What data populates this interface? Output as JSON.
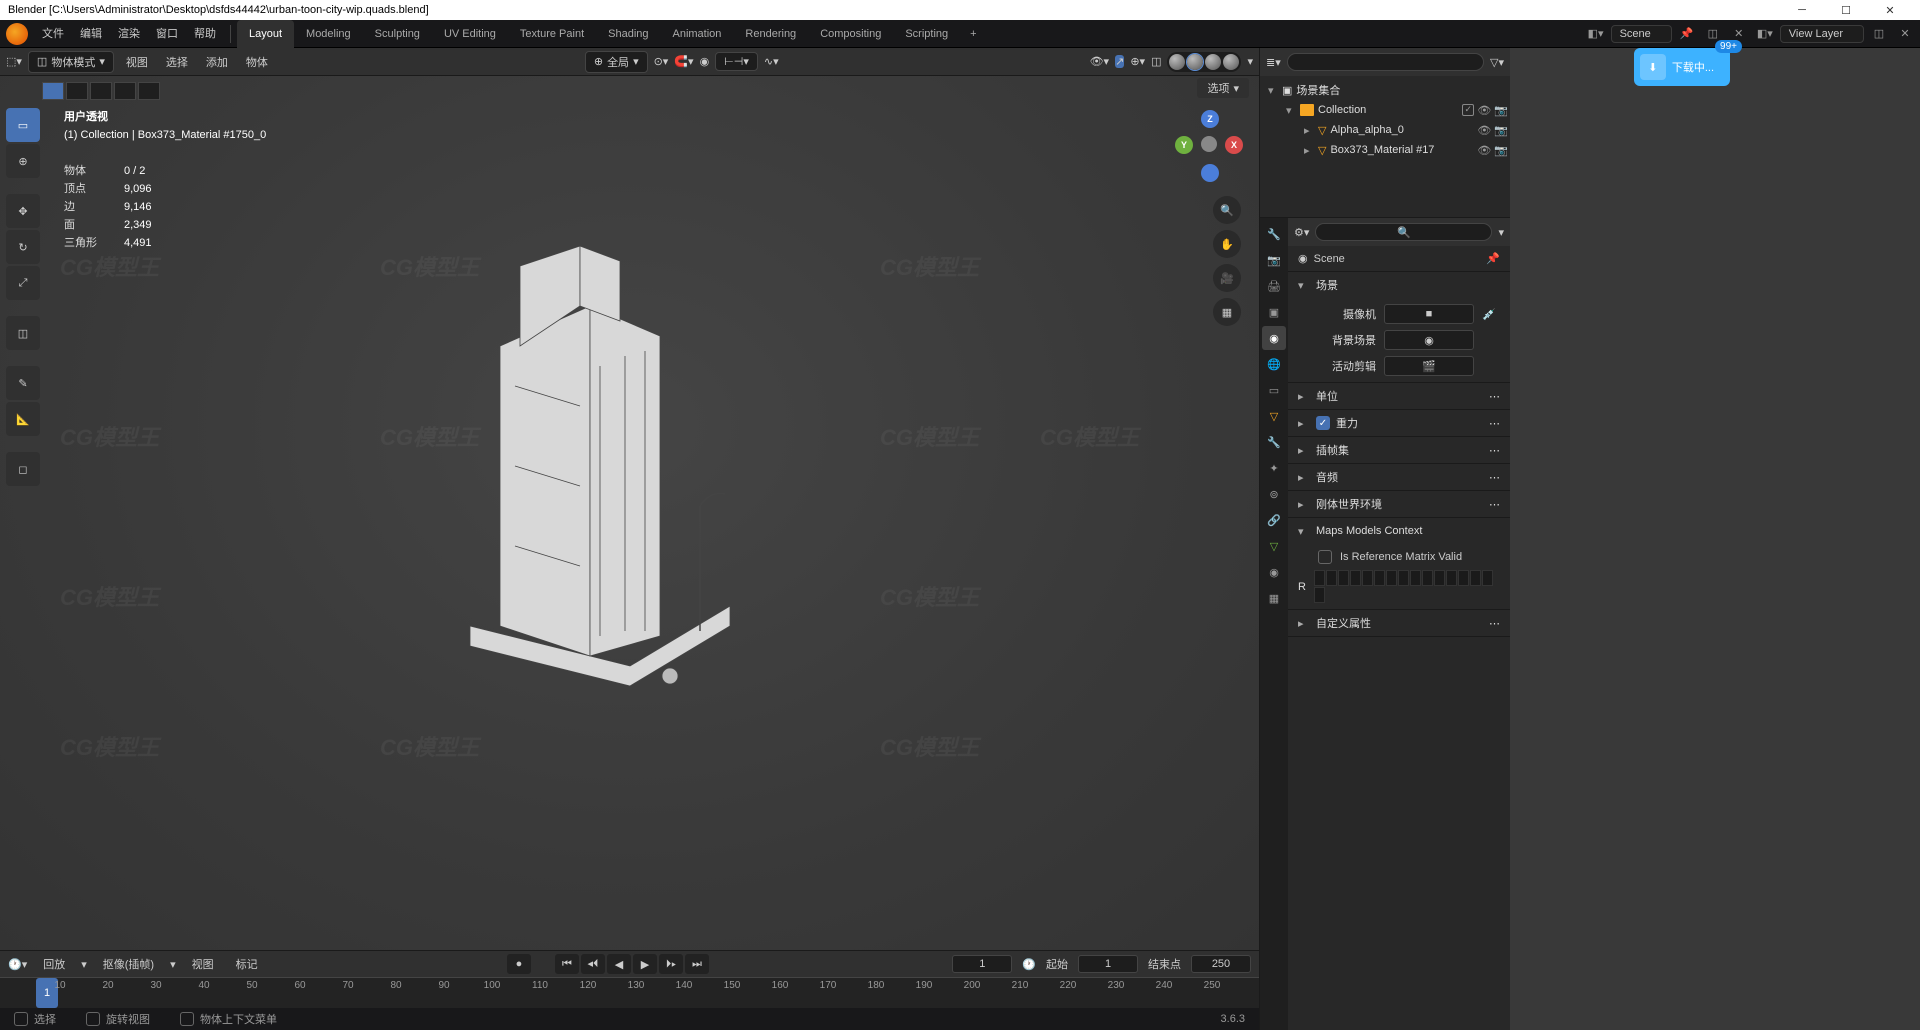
{
  "titlebar": {
    "title": "Blender [C:\\Users\\Administrator\\Desktop\\dsfds44442\\urban-toon-city-wip.quads.blend]"
  },
  "menu": {
    "items": [
      "文件",
      "编辑",
      "渲染",
      "窗口",
      "帮助"
    ]
  },
  "workspace_tabs": [
    "Layout",
    "Modeling",
    "Sculpting",
    "UV Editing",
    "Texture Paint",
    "Shading",
    "Animation",
    "Rendering",
    "Compositing",
    "Scripting"
  ],
  "scene_dropdown": "Scene",
  "layer_dropdown": "View Layer",
  "download": {
    "label": "下载中...",
    "badge": "99+"
  },
  "view3d_header": {
    "mode": "物体模式",
    "menus": [
      "视图",
      "选择",
      "添加",
      "物体"
    ],
    "pivot": "全局",
    "options": "选项"
  },
  "overlay": {
    "title": "用户透视",
    "subtitle": "(1) Collection | Box373_Material #1750_0",
    "stats": [
      {
        "label": "物体",
        "value": "0 / 2"
      },
      {
        "label": "顶点",
        "value": "9,096"
      },
      {
        "label": "边",
        "value": "9,146"
      },
      {
        "label": "面",
        "value": "2,349"
      },
      {
        "label": "三角形",
        "value": "4,491"
      }
    ]
  },
  "gizmo": {
    "x": "X",
    "y": "Y",
    "z": "Z"
  },
  "timeline": {
    "menus": [
      "回放",
      "抠像(插帧)",
      "视图",
      "标记"
    ],
    "current_frame": "1",
    "start_label": "起始",
    "start": "1",
    "end_label": "结束点",
    "end": "250",
    "playhead": "1",
    "ticks": [
      "10",
      "20",
      "30",
      "40",
      "50",
      "60",
      "70",
      "80",
      "90",
      "100",
      "110",
      "120",
      "130",
      "140",
      "150",
      "160",
      "170",
      "180",
      "190",
      "200",
      "210",
      "220",
      "230",
      "240",
      "250"
    ]
  },
  "statusbar": {
    "items": [
      "选择",
      "旋转视图",
      "物体上下文菜单"
    ],
    "version": "3.6.3"
  },
  "outliner": {
    "root": "场景集合",
    "items": [
      {
        "name": "Collection",
        "type": "collection",
        "indent": 1
      },
      {
        "name": "Alpha_alpha_0",
        "type": "mesh",
        "indent": 2
      },
      {
        "name": "Box373_Material #17",
        "type": "mesh",
        "indent": 2
      }
    ]
  },
  "properties": {
    "breadcrumb": "Scene",
    "panels": {
      "scene": {
        "title": "场景",
        "camera_label": "摄像机",
        "bg_label": "背景场景",
        "clip_label": "活动剪辑"
      },
      "units": "单位",
      "gravity": "重力",
      "keying": "插帧集",
      "audio": "音频",
      "rigid": "刚体世界环境",
      "maps": {
        "title": "Maps Models Context",
        "ref_label": "Is Reference Matrix Valid",
        "r_label": "R"
      },
      "custom": "自定义属性"
    }
  }
}
